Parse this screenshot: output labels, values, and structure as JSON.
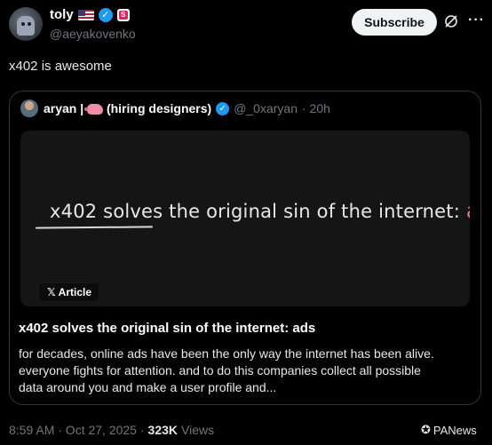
{
  "author": {
    "name": "toly",
    "handle": "@aeyakovenko",
    "badge_letter": "S"
  },
  "header": {
    "subscribe_label": "Subscribe",
    "more_label": "···"
  },
  "tweet": {
    "text": "x402 is awesome"
  },
  "quote": {
    "name_prefix": "aryan |",
    "name_suffix": "(hiring designers)",
    "handle": "@_0xaryan",
    "time": "· 20h",
    "media": {
      "headline_main": "x402 solves the original sin of the internet:",
      "headline_highlight": "ads",
      "chip_label": "Article"
    },
    "title": "x402 solves the original sin of the internet: ads",
    "body_lines": [
      "for decades, online ads have been the only way the internet has been alive.",
      "everyone fights for attention. and to do this companies collect all possible",
      "data around you and make a user profile and..."
    ]
  },
  "meta": {
    "time": "8:59 AM · Oct 27, 2025 ·",
    "views_count": "323K",
    "views_label": "Views"
  },
  "watermark": {
    "text": "PANews"
  },
  "colors": {
    "background": "#000000",
    "accent": "#1d9bf0",
    "muted": "#71767b",
    "highlight": "#f07d88"
  }
}
